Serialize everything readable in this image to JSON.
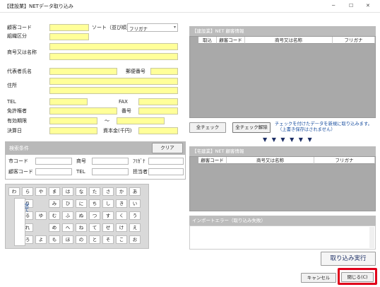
{
  "title": "【建設業】NETデータ取り込み",
  "form": {
    "customer_code": "顧客コード",
    "org_class": "組織区分",
    "sort_label": "ソート（並び順）",
    "sort_value": "フリガナ",
    "trade_name": "商号又は名称",
    "representative": "代表者氏名",
    "postal": "郵便番号",
    "address": "住所",
    "tel": "TEL",
    "fax": "FAX",
    "license_holder": "免許権者",
    "number": "番号",
    "validity": "有効期限",
    "tilde": "～",
    "settlement": "決算日",
    "capital": "資本金(千円)"
  },
  "search": {
    "title": "検索条件",
    "clear": "クリア",
    "city_code": "市コード",
    "trade": "商号",
    "furigana": "ﾌﾘｶﾞﾅ",
    "cust_code": "顧客コード",
    "tel": "TEL",
    "staff": "担当者"
  },
  "kana_rows": [
    [
      "わ",
      "ら",
      "や",
      "ま",
      "は",
      "な",
      "た",
      "さ",
      "か",
      "あ"
    ],
    [
      "",
      "り",
      "",
      "み",
      "ひ",
      "に",
      "ち",
      "し",
      "き",
      "い"
    ],
    [
      "",
      "る",
      "ゆ",
      "む",
      "ふ",
      "ぬ",
      "つ",
      "す",
      "く",
      "う"
    ],
    [
      "",
      "れ",
      "",
      "め",
      "へ",
      "ね",
      "て",
      "せ",
      "け",
      "え"
    ],
    [
      "",
      "ろ",
      "よ",
      "も",
      "ほ",
      "の",
      "と",
      "そ",
      "こ",
      "お"
    ]
  ],
  "kana_all": "全て",
  "construction_panel": {
    "title": "【建設業】NET 顧客情報",
    "columns": [
      "取込",
      "顧客コード",
      "商号又は名称",
      "フリガナ"
    ]
  },
  "check_all": "全チェック",
  "uncheck_all": "全チェック解除",
  "check_note_1": "チェックを付けたデータを新規に取り込みます。",
  "check_note_2": "（上書き保存はされません）",
  "arrows": "▼ ▼ ▼ ▼ ▼ ▼",
  "realestate_panel": {
    "title": "【宅建業】NET 顧客情報",
    "columns": [
      "顧客コード",
      "商号又は名称",
      "フリガナ"
    ]
  },
  "import_error_title": "インポートエラー（取り込み失敗）",
  "execute": "取り込み実行",
  "cancel": "キャンセル",
  "close": "閉じる(C)",
  "accent_color": "#1a4fa0",
  "highlight_color": "#e0001a"
}
